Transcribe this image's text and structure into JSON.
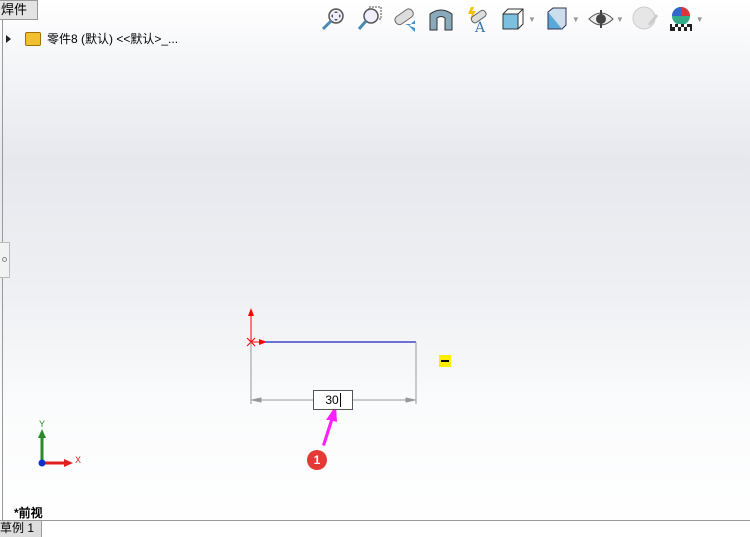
{
  "top_tab": {
    "label": "焊件"
  },
  "tree": {
    "item_label": "零件8 (默认) <<默认>_..."
  },
  "toolbar": {
    "icons": [
      "zoom-to-fit-icon",
      "zoom-to-area-icon",
      "previous-view-icon",
      "section-view-icon",
      "dynamic-annotation-icon",
      "view-orientation-icon",
      "display-style-icon",
      "hide-show-items-icon",
      "edit-appearance-icon",
      "apply-scene-icon"
    ]
  },
  "sketch": {
    "dimension_value": "30",
    "callout_number": "1"
  },
  "triad": {
    "x_label": "X",
    "y_label": "Y"
  },
  "view_label": "*前视",
  "bottom_tab": {
    "label": "草例 1"
  },
  "colors": {
    "sketch_line": "#2020c0",
    "origin": "#ff0000",
    "callout": "#e53935",
    "arrow": "#ff22ff"
  }
}
